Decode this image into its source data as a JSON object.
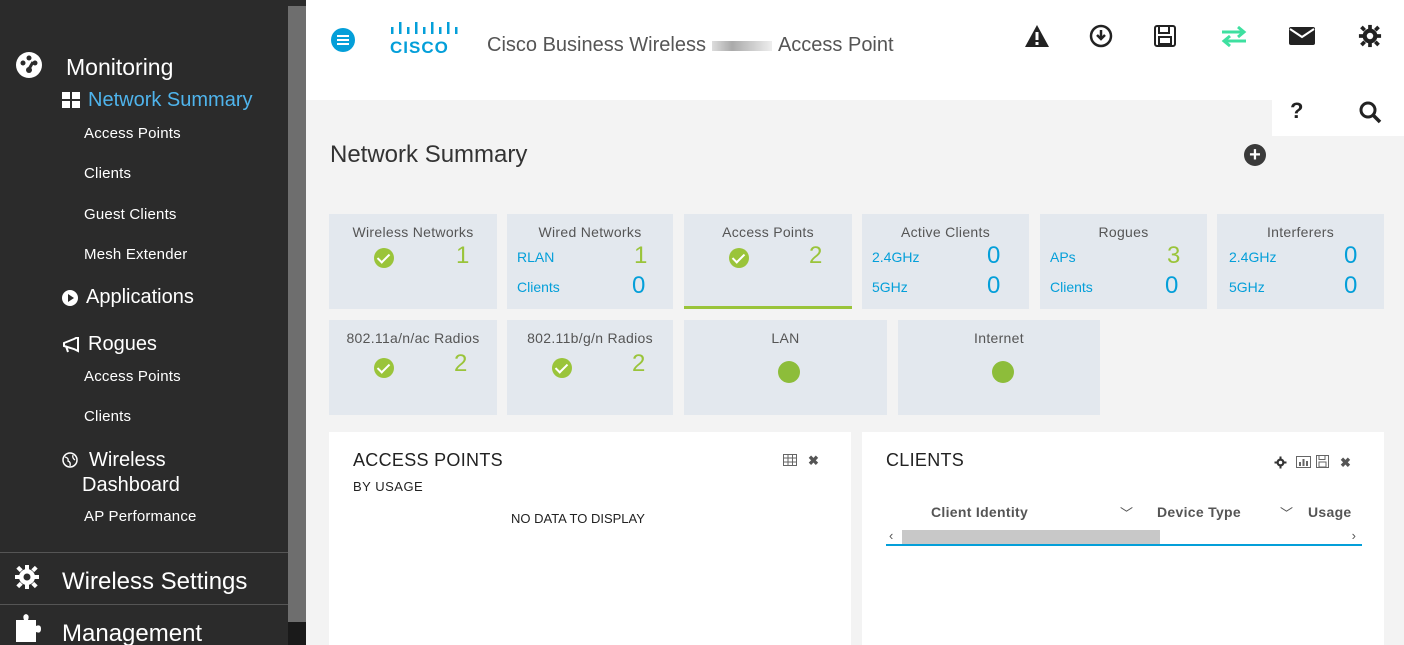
{
  "sidebar": {
    "monitoring": "Monitoring",
    "network_summary": "Network Summary",
    "access_points": "Access Points",
    "clients": "Clients",
    "guest_clients": "Guest Clients",
    "mesh_extender": "Mesh Extender",
    "applications": "Applications",
    "rogues": "Rogues",
    "rogues_access_points": "Access Points",
    "rogues_clients": "Clients",
    "wireless_dashboard_line1": "Wireless",
    "wireless_dashboard_line2": "Dashboard",
    "ap_performance": "AP Performance",
    "wireless_settings": "Wireless Settings",
    "management": "Management"
  },
  "header": {
    "logo_text": "CISCO",
    "title_part1": "Cisco Business Wireless",
    "title_part2": "Access Point"
  },
  "page": {
    "title": "Network Summary"
  },
  "tiles_row1": [
    {
      "title": "Wireless Networks",
      "value": "1"
    },
    {
      "title": "Wired Networks",
      "rlan_label": "RLAN",
      "rlan_value": "1",
      "clients_label": "Clients",
      "clients_value": "0"
    },
    {
      "title": "Access Points",
      "value": "2"
    },
    {
      "title": "Active Clients",
      "a_label": "2.4GHz",
      "a_value": "0",
      "b_label": "5GHz",
      "b_value": "0"
    },
    {
      "title": "Rogues",
      "a_label": "APs",
      "a_value": "3",
      "b_label": "Clients",
      "b_value": "0"
    },
    {
      "title": "Interferers",
      "a_label": "2.4GHz",
      "a_value": "0",
      "b_label": "5GHz",
      "b_value": "0"
    }
  ],
  "tiles_row2": [
    {
      "title": "802.11a/n/ac Radios",
      "value": "2"
    },
    {
      "title": "802.11b/g/n Radios",
      "value": "2"
    },
    {
      "title": "LAN"
    },
    {
      "title": "Internet"
    }
  ],
  "ap_panel": {
    "title": "ACCESS POINTS",
    "subtitle": "BY USAGE",
    "empty": "NO DATA TO DISPLAY"
  },
  "clients_panel": {
    "title": "CLIENTS",
    "col1": "Client Identity",
    "col2": "Device Type",
    "col3": "Usage"
  },
  "colors": {
    "accent": "#049fd9",
    "ok_green": "#9ac43a",
    "sidebar_bg": "#2b2b2b",
    "tile_bg": "#e3e8ee",
    "sync_icon": "#3ee0a0"
  }
}
